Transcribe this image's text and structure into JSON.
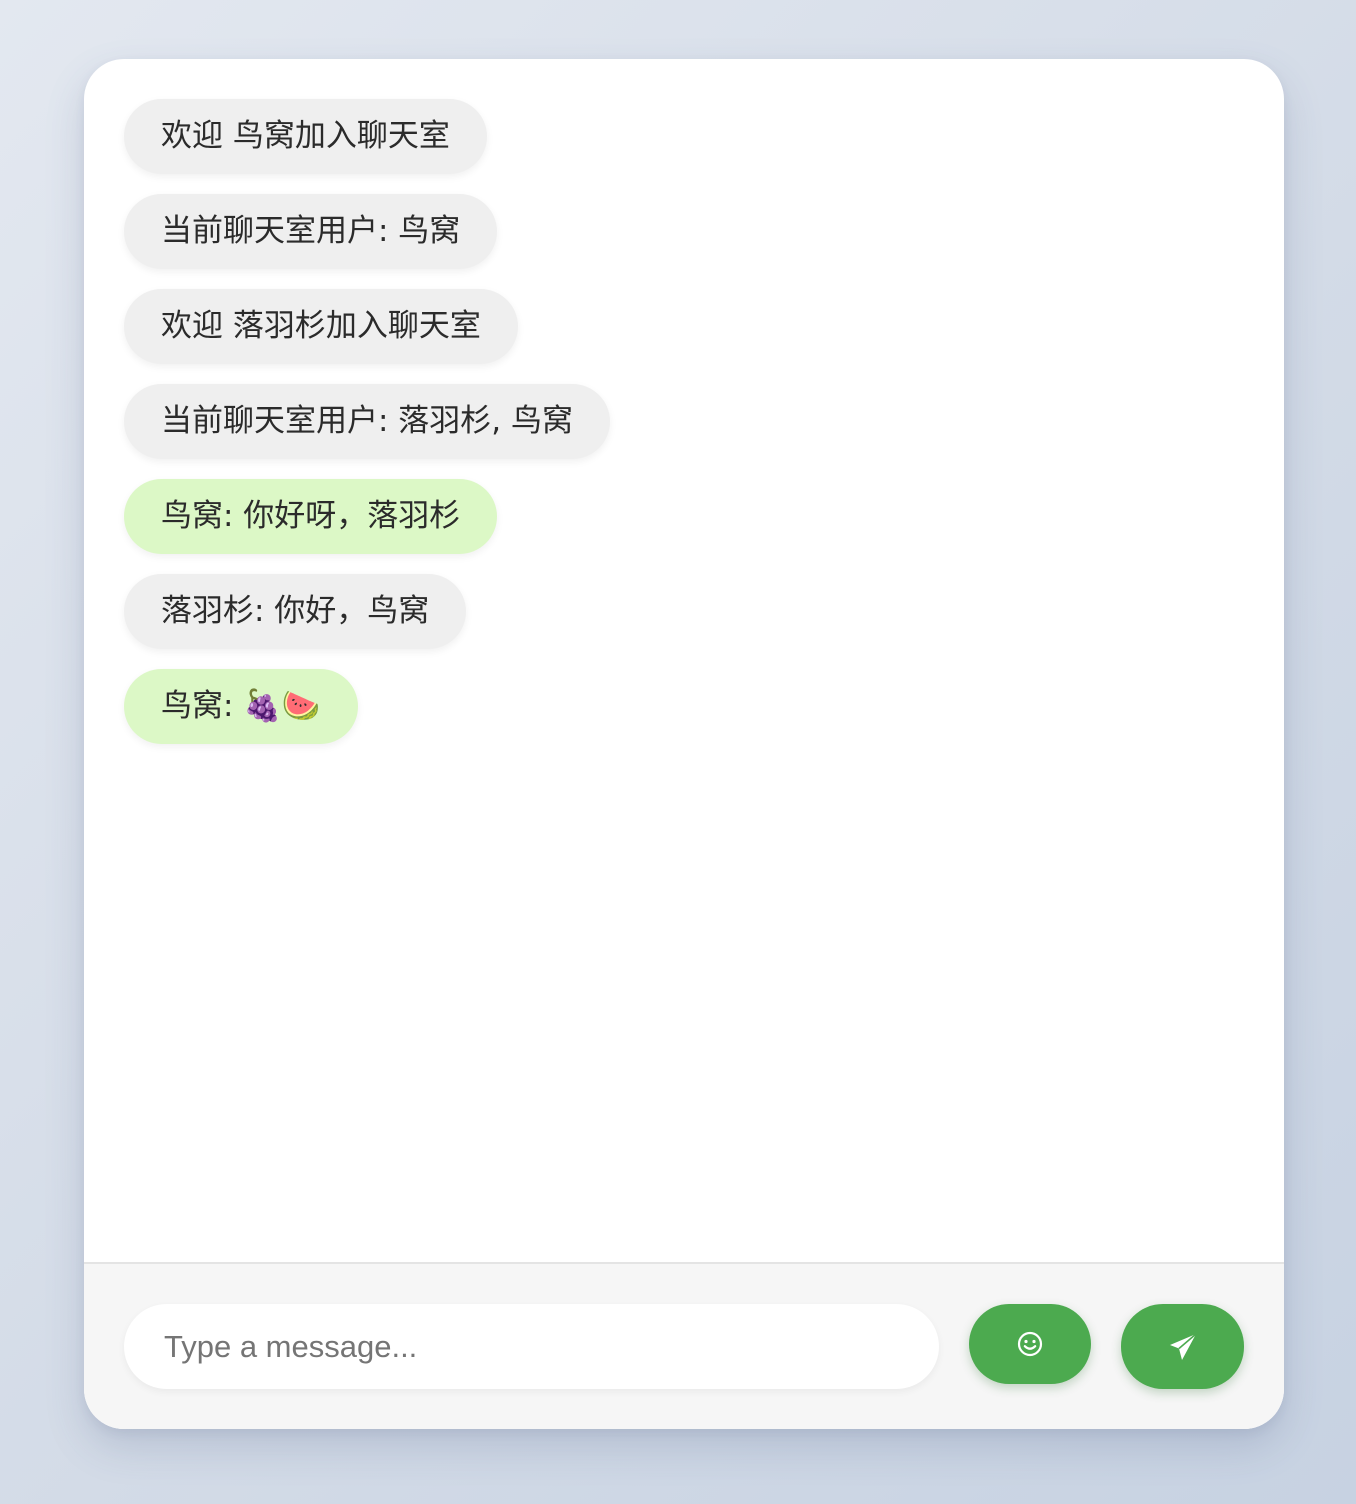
{
  "messages": [
    {
      "type": "system",
      "text": "欢迎 鸟窝加入聊天室"
    },
    {
      "type": "system",
      "text": "当前聊天室用户: 鸟窝"
    },
    {
      "type": "system",
      "text": "欢迎 落羽杉加入聊天室"
    },
    {
      "type": "system",
      "text": "当前聊天室用户: 落羽杉, 鸟窝"
    },
    {
      "type": "self",
      "text": "鸟窝: 你好呀，落羽杉"
    },
    {
      "type": "other",
      "text": "落羽杉: 你好，鸟窝"
    },
    {
      "type": "self",
      "text": "鸟窝: 🍇🍉"
    }
  ],
  "composer": {
    "placeholder": "Type a message...",
    "value": "",
    "emoji_icon": "smiley-icon",
    "send_icon": "paper-plane-icon"
  },
  "colors": {
    "accent": "#4caa4f",
    "self_bubble": "#dcf8c6",
    "other_bubble": "#efefef",
    "card_background": "#ffffff",
    "composer_background": "#f6f6f6"
  }
}
